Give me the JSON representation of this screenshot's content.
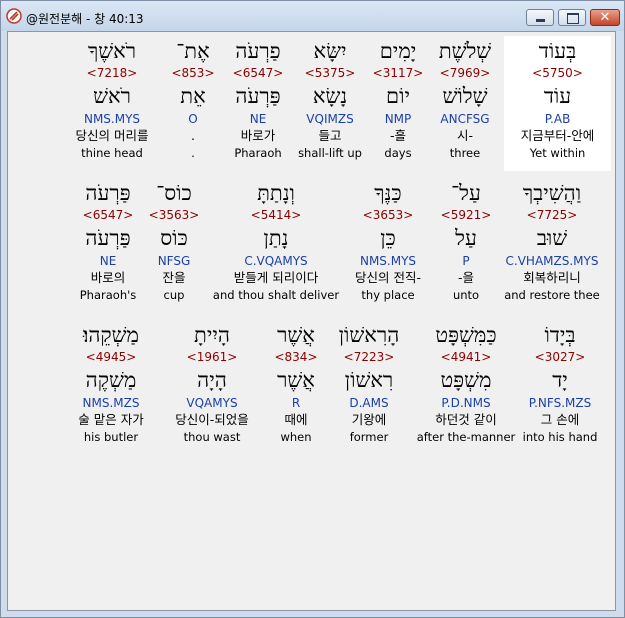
{
  "window": {
    "title": "@원전분해 - 창 40:13",
    "close_symbol": "✕"
  },
  "rows": [
    {
      "cells": [
        {
          "heb": "בְּעוֹד",
          "strong": "<5750>",
          "lex": "עוֹד",
          "parse": "P.AB",
          "kor": "지금부터-안에",
          "eng": "Yet within",
          "highlight": true
        },
        {
          "heb": "שְׁלֹשֶׁת",
          "strong": "<7969>",
          "lex": "שָׁלוֹשׁ",
          "parse": "ANCFSG",
          "kor": "시-",
          "eng": "three"
        },
        {
          "heb": "יָמִים",
          "strong": "<3117>",
          "lex": "יוֹם",
          "parse": "NMP",
          "kor": "-흘",
          "eng": "days"
        },
        {
          "heb": "יִשָּׂא",
          "strong": "<5375>",
          "lex": "נָשָׂא",
          "parse": "VQIMZS",
          "kor": "들고",
          "eng": "shall-lift up"
        },
        {
          "heb": "פַרְעֹה",
          "strong": "<6547>",
          "lex": "פַּרְעֹה",
          "parse": "NE",
          "kor": "바로가",
          "eng": "Pharaoh"
        },
        {
          "heb": "אֶת־",
          "strong": "<853>",
          "lex": "אֵת",
          "parse": "O",
          "kor": ".",
          "eng": "."
        },
        {
          "heb": "רֹאשֶׁךָ",
          "strong": "<7218>",
          "lex": "רֹאשׁ",
          "parse": "NMS.MYS",
          "kor": "당신의 머리를",
          "eng": "thine head"
        }
      ]
    },
    {
      "cells": [
        {
          "heb": "וַהֲשִׁיבְךָ",
          "strong": "<7725>",
          "lex": "שׁוּב",
          "parse": "C.VHAMZS.MYS",
          "kor": "회복하리니",
          "eng": "and restore thee"
        },
        {
          "heb": "עַל־",
          "strong": "<5921>",
          "lex": "עַל",
          "parse": "P",
          "kor": "-을",
          "eng": "unto"
        },
        {
          "heb": "כַּנֶּךָ",
          "strong": "<3653>",
          "lex": "כֵּן",
          "parse": "NMS.MYS",
          "kor": "당신의 전직-",
          "eng": "thy place"
        },
        {
          "heb": "וְנָתַתָּ",
          "strong": "<5414>",
          "lex": "נָתַן",
          "parse": "C.VQAMYS",
          "kor": "받들게 되리이다",
          "eng": "and thou shalt deliver"
        },
        {
          "heb": "כוֹס־",
          "strong": "<3563>",
          "lex": "כּוֹס",
          "parse": "NFSG",
          "kor": "잔을",
          "eng": "cup"
        },
        {
          "heb": "פַּרְעֹה",
          "strong": "<6547>",
          "lex": "פַּרְעֹה",
          "parse": "NE",
          "kor": "바로의",
          "eng": "Pharaoh's"
        }
      ]
    },
    {
      "cells": [
        {
          "heb": "בְּיָדוֹ",
          "strong": "<3027>",
          "lex": "יָד",
          "parse": "P.NFS.MZS",
          "kor": "그 손에",
          "eng": "into his hand"
        },
        {
          "heb": "כַּמִּשְׁפָּט",
          "strong": "<4941>",
          "lex": "מִשְׁפָּט",
          "parse": "P.D.NMS",
          "kor": "하던것 같이",
          "eng": "after the-manner"
        },
        {
          "heb": "הָרִאשׁוֹן",
          "strong": "<7223>",
          "lex": "רִאשׁוֹן",
          "parse": "D.AMS",
          "kor": "기왕에",
          "eng": "former"
        },
        {
          "heb": "אֲשֶׁר",
          "strong": "<834>",
          "lex": "אֲשֶׁר",
          "parse": "R",
          "kor": "때에",
          "eng": "when"
        },
        {
          "heb": "הָיִיתָ",
          "strong": "<1961>",
          "lex": "הָיָה",
          "parse": "VQAMYS",
          "kor": "당신이-되었을",
          "eng": "thou wast"
        },
        {
          "heb": "מַשְׁקֵהוּ׃",
          "strong": "<4945>",
          "lex": "מַשְׁקֶה",
          "parse": "NMS.MZS",
          "kor": "술 맡은 자가",
          "eng": "his butler"
        }
      ]
    }
  ]
}
